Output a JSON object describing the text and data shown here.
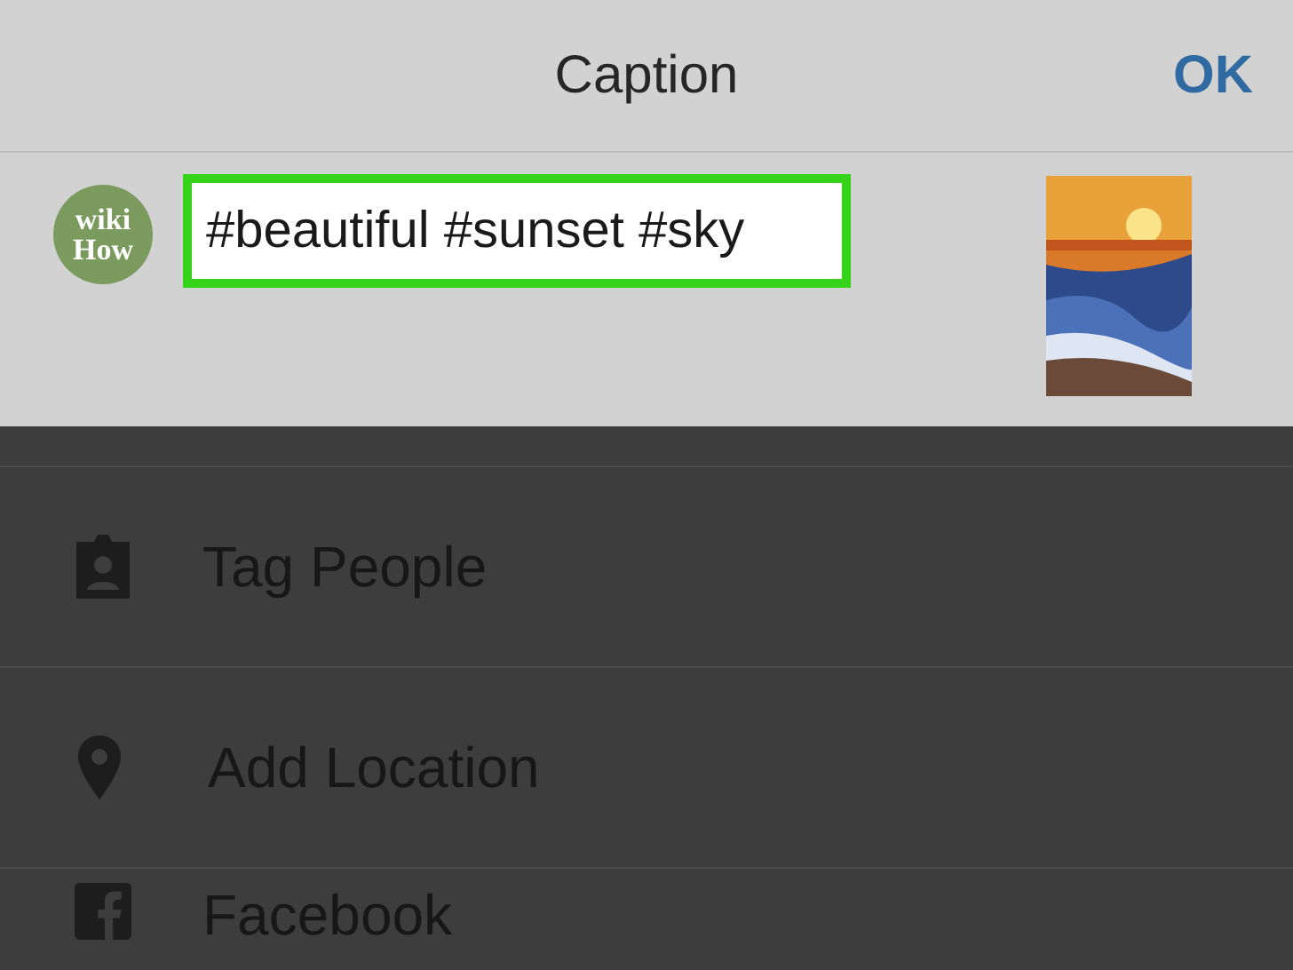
{
  "header": {
    "title": "Caption",
    "action": "OK"
  },
  "composer": {
    "avatar": [
      "wiki",
      "How"
    ],
    "caption": "#beautiful #sunset #sky",
    "highlighted": true
  },
  "options": [
    {
      "kind": "tag",
      "label": "Tag People"
    },
    {
      "kind": "location",
      "label": "Add Location"
    },
    {
      "kind": "facebook",
      "label": "Facebook"
    }
  ]
}
